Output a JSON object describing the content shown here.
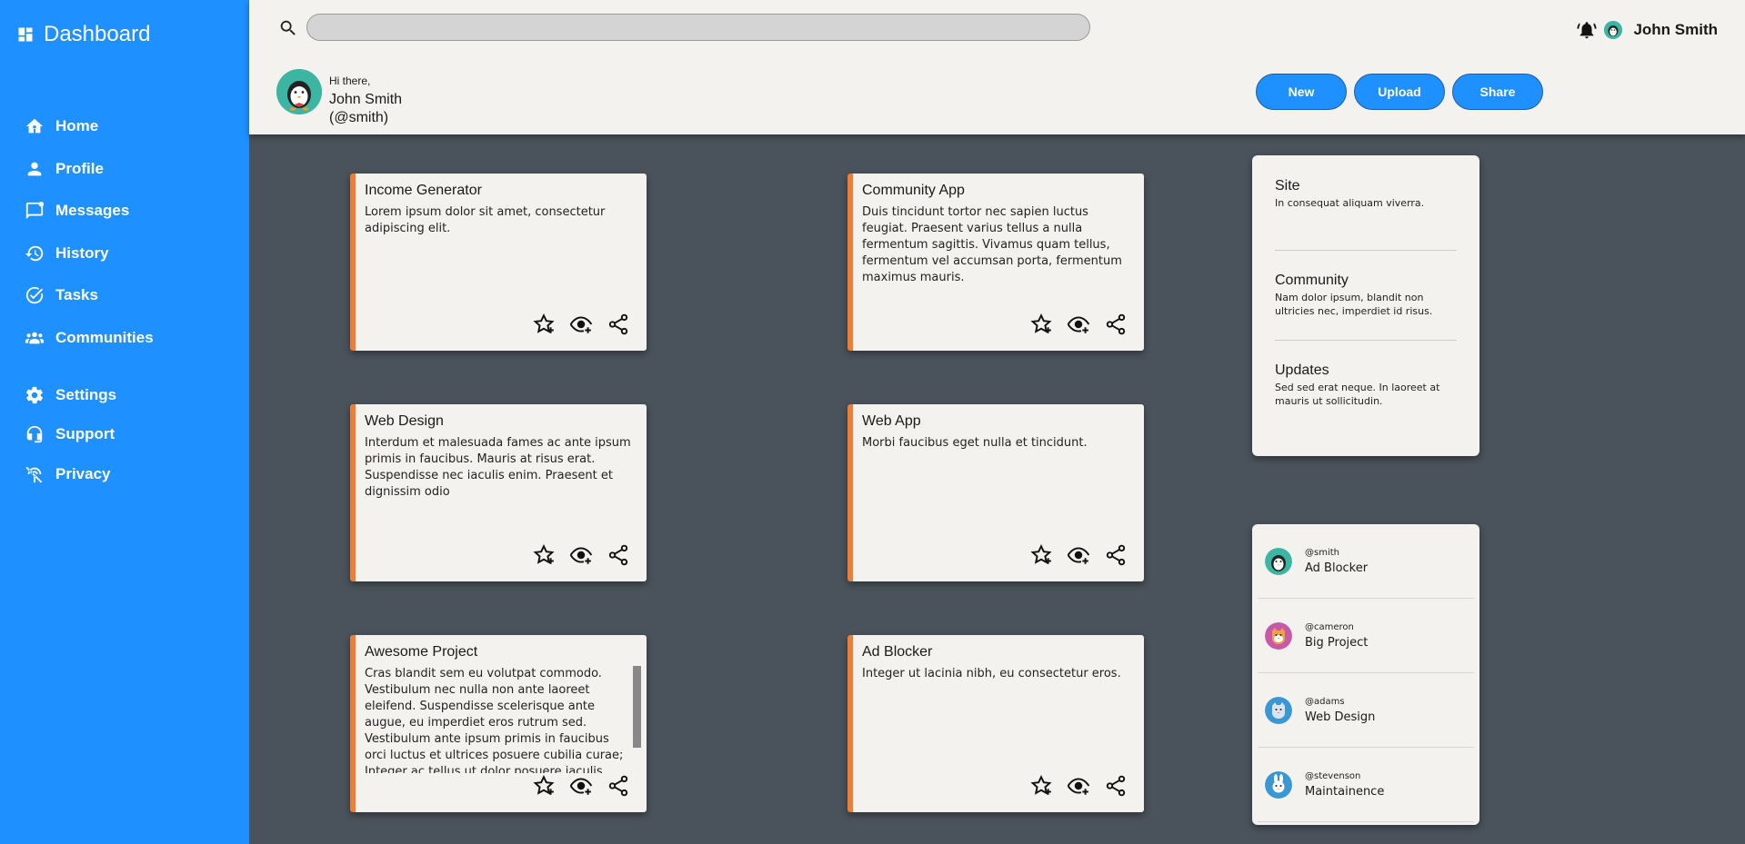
{
  "sidebar": {
    "brand": "Dashboard",
    "items": [
      {
        "label": "Home",
        "icon": "home-icon"
      },
      {
        "label": "Profile",
        "icon": "person-icon"
      },
      {
        "label": "Messages",
        "icon": "message-icon"
      },
      {
        "label": "History",
        "icon": "history-icon"
      },
      {
        "label": "Tasks",
        "icon": "task-icon"
      },
      {
        "label": "Communities",
        "icon": "group-icon"
      }
    ],
    "secondary": [
      {
        "label": "Settings",
        "icon": "gear-icon"
      },
      {
        "label": "Support",
        "icon": "support-icon"
      },
      {
        "label": "Privacy",
        "icon": "privacy-icon"
      }
    ]
  },
  "header": {
    "search_placeholder": "",
    "user_name": "John Smith",
    "greeting": "Hi there,",
    "greet_name": "John Smith",
    "greet_handle": "(@smith)",
    "actions": [
      "New",
      "Upload",
      "Share"
    ]
  },
  "cards": [
    {
      "title": "Income Generator",
      "text": "Lorem ipsum dolor sit amet, consectetur adipiscing elit."
    },
    {
      "title": "Community App",
      "text": "Duis tincidunt tortor nec sapien luctus feugiat. Praesent varius tellus a nulla fermentum sagittis. Vivamus quam tellus, fermentum vel accumsan porta, fermentum maximus mauris."
    },
    {
      "title": "Web Design",
      "text": "Interdum et malesuada fames ac ante ipsum primis in faucibus. Mauris at risus erat. Suspendisse nec iaculis enim. Praesent et dignissim odio"
    },
    {
      "title": "Web App",
      "text": "Morbi faucibus eget nulla et tincidunt."
    },
    {
      "title": "Awesome Project",
      "text": "Cras blandit sem eu volutpat commodo. Vestibulum nec nulla non ante laoreet eleifend. Suspendisse scelerisque ante augue, eu imperdiet eros rutrum sed. Vestibulum ante ipsum primis in faucibus orci luctus et ultrices posuere cubilia curae; Integer ac tellus ut dolor posuere iaculis quis"
    },
    {
      "title": "Ad Blocker",
      "text": "Integer ut lacinia nibh, eu consectetur eros."
    }
  ],
  "info": [
    {
      "title": "Site",
      "text": "In consequat aliquam viverra."
    },
    {
      "title": "Community",
      "text": "Nam dolor ipsum, blandit non ultricies nec, imperdiet id risus."
    },
    {
      "title": "Updates",
      "text": "Sed sed erat neque. In laoreet at mauris ut sollicitudin."
    }
  ],
  "activity": [
    {
      "handle": "@smith",
      "project": "Ad Blocker",
      "color": "#3cb5a2"
    },
    {
      "handle": "@cameron",
      "project": "Big Project",
      "color": "#c75aa8"
    },
    {
      "handle": "@adams",
      "project": "Web Design",
      "color": "#3a97d4"
    },
    {
      "handle": "@stevenson",
      "project": "Maintainence",
      "color": "#3a97d4"
    }
  ],
  "colors": {
    "accent": "#1e90ff",
    "card_border": "#ef7d34",
    "background": "#4a525b"
  }
}
